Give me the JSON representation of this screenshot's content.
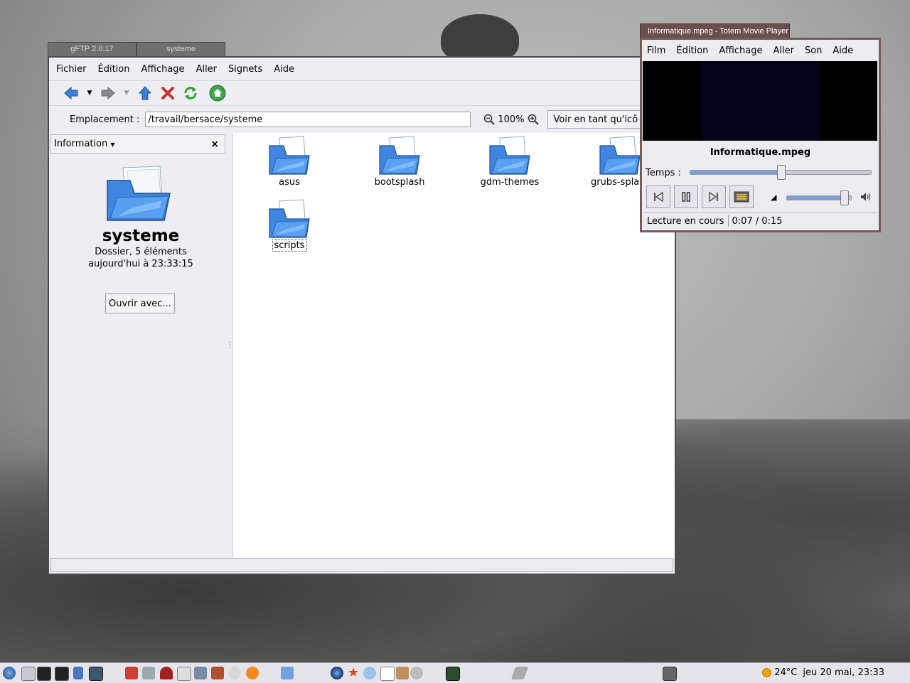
{
  "window_tabs": [
    "gFTP 2.0.17",
    "systeme"
  ],
  "nautilus": {
    "menu": [
      "Fichier",
      "Édition",
      "Affichage",
      "Aller",
      "Signets",
      "Aide"
    ],
    "location_label": "Emplacement :",
    "location_value": "/travail/bersace/systeme",
    "zoom": "100%",
    "view_as": "Voir en tant qu'icô",
    "side_pane": {
      "selector": "Information",
      "folder_name": "systeme",
      "details": "Dossier, 5 éléments",
      "modified": "aujourd'hui à 23:33:15",
      "open_with": "Ouvrir avec..."
    },
    "files": [
      "asus",
      "bootsplash",
      "gdm-themes",
      "grubs-spla",
      "scripts"
    ]
  },
  "totem": {
    "title": "Informatique.mpeg - Totem Movie Player",
    "menu": [
      "Film",
      "Édition",
      "Affichage",
      "Aller",
      "Son",
      "Aide"
    ],
    "media_name": "Informatique.mpeg",
    "time_label": "Temps :",
    "progress": 0.5,
    "volume": 0.88,
    "status": "Lecture en cours",
    "time": "0:07 / 0:15"
  },
  "taskbar": {
    "weather": "24°C",
    "clock": "jeu 20 mai, 23:33"
  },
  "colors": {
    "folder_blue": "#3f86e0",
    "totem_frame": "#7a5a57",
    "taskbar_bg": "#e4e4ea"
  }
}
